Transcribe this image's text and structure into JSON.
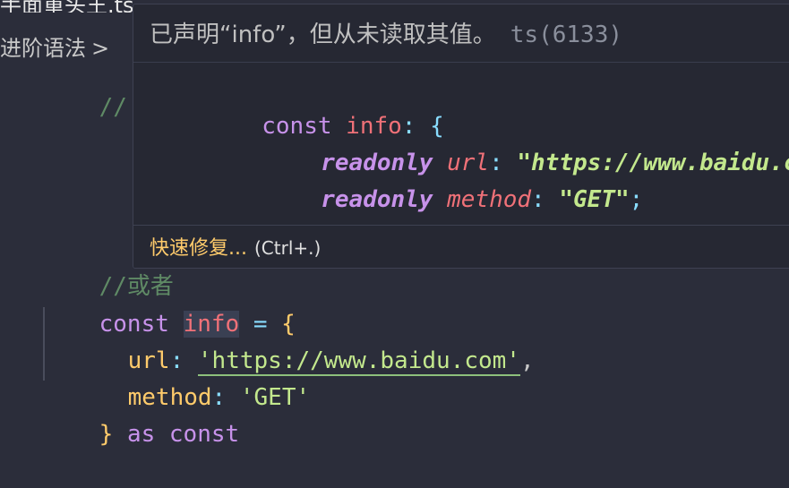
{
  "tab": {
    "title": "手面重头王.ts"
  },
  "breadcrumb": {
    "label": "进阶语法",
    "chevron": ">"
  },
  "editor": {
    "line1_comment": "// }",
    "comment_or": "//或者",
    "const_kw": "const",
    "var_name": "info",
    "assign": "=",
    "open_brace": "{",
    "url_prop": "url",
    "colon": ":",
    "url_value": "'https://www.baidu.com'",
    "comma": ",",
    "method_prop": "method",
    "method_value": "'GET'",
    "close_brace": "}",
    "as_kw": "as",
    "const_kw2": "const"
  },
  "hover": {
    "message": "已声明“info”，但从未读取其值。",
    "code": "ts(6133)",
    "decl_const": "const",
    "decl_name": "info",
    "decl_colon": ":",
    "decl_open": "{",
    "readonly1": "readonly",
    "url_prop": "url",
    "url_colon": ":",
    "url_type": "\"https://www.baidu.com\"",
    "semi1": ";",
    "readonly2": "readonly",
    "method_prop": "method",
    "method_colon": ":",
    "method_type": "\"GET\"",
    "semi2": ";",
    "decl_close": "}",
    "quick_fix": "快速修复...",
    "shortcut": "(Ctrl+.)"
  },
  "colors": {
    "background": "#2b2d3a",
    "keyword": "#c792ea",
    "variable": "#f07178",
    "string": "#c3e88d",
    "brace": "#ffcb6b",
    "comment": "#5f8a65"
  }
}
